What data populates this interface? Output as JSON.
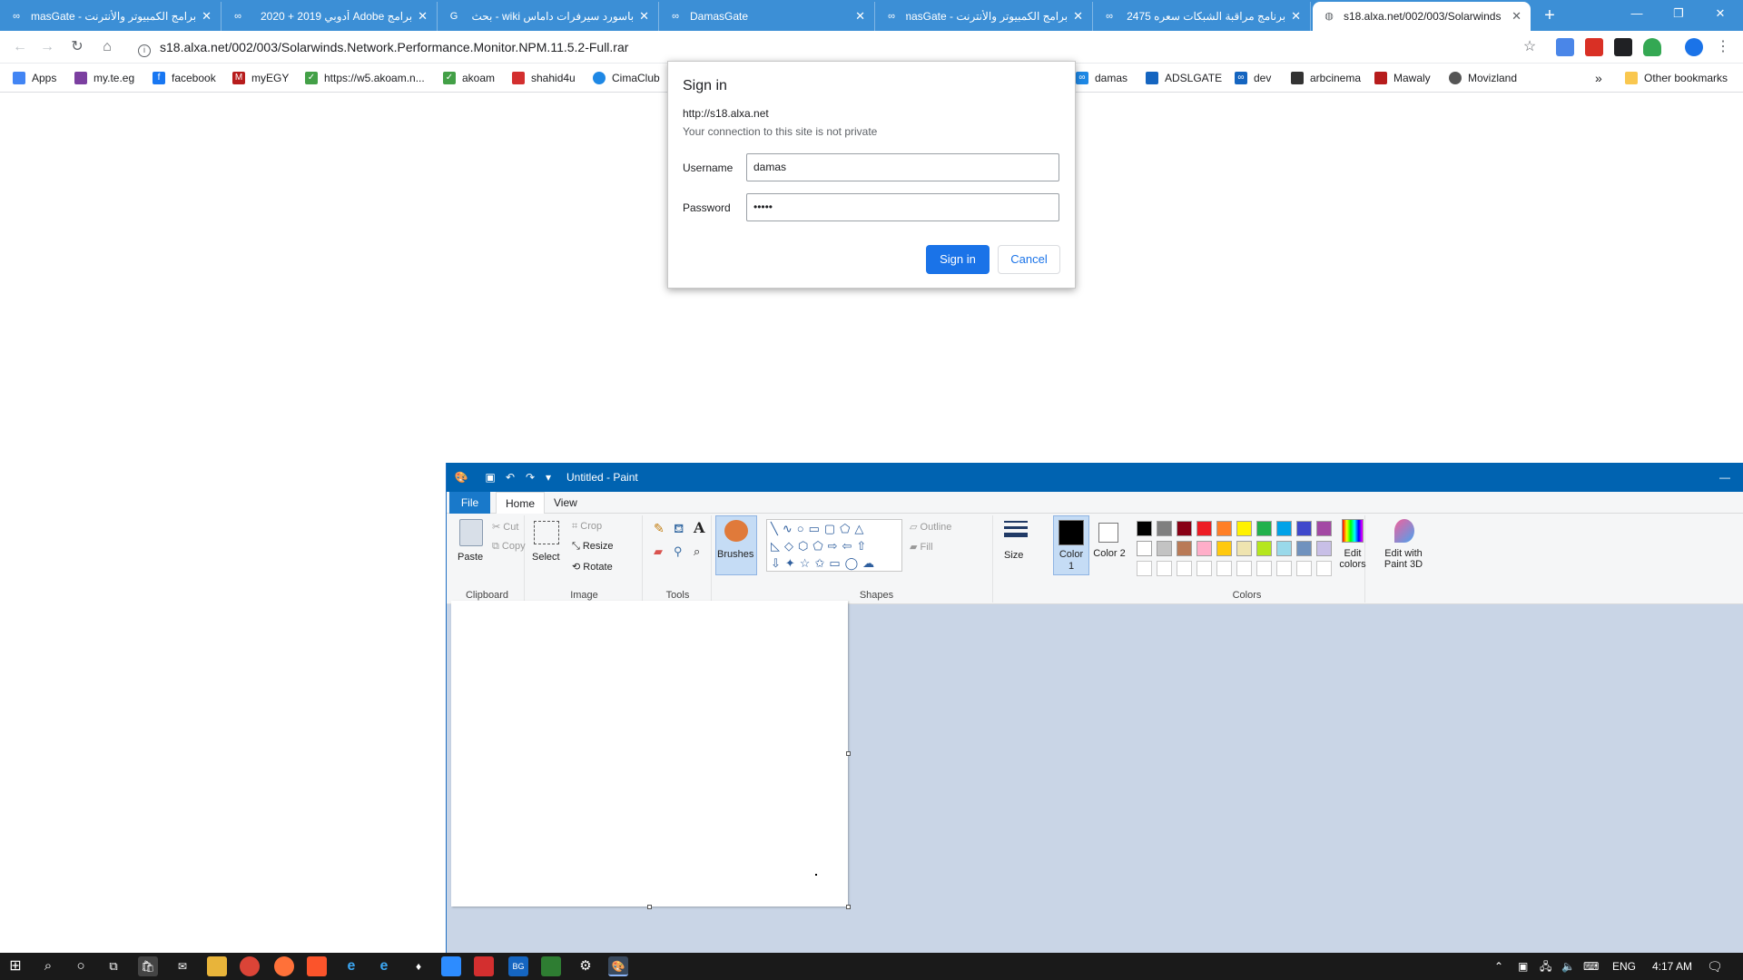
{
  "browser": {
    "tabs": [
      {
        "title": "برامج الكمبيوتر والأنترنت - masGate"
      },
      {
        "title": "برامج Adobe أدوبي 2019 + 2020"
      },
      {
        "title": "باسورد سيرفرات داماس wiki - بحث"
      },
      {
        "title": "DamasGate"
      },
      {
        "title": "برامج الكمبيوتر والأنترنت - masGate"
      },
      {
        "title": "برنامج مراقبة الشبكات سعره 2475"
      },
      {
        "title": "s18.alxa.net/002/003/Solarwinds"
      }
    ],
    "address": "s18.alxa.net/002/003/Solarwinds.Network.Performance.Monitor.NPM.11.5.2-Full.rar",
    "bookmarks": [
      {
        "label": "Apps",
        "color": "#4285f4"
      },
      {
        "label": "my.te.eg",
        "color": "#7b3fa0"
      },
      {
        "label": "facebook",
        "color": "#1877f2"
      },
      {
        "label": "myEGY",
        "color": "#b71c1c"
      },
      {
        "label": "https://w5.akoam.n...",
        "color": "#43a047"
      },
      {
        "label": "akoam",
        "color": "#43a047"
      },
      {
        "label": "shahid4u",
        "color": "#d32f2f"
      },
      {
        "label": "CimaClub",
        "color": "#1e88e5"
      },
      {
        "label": "damas",
        "color": "#1e88e5"
      },
      {
        "label": "ADSLGATE",
        "color": "#1565c0"
      },
      {
        "label": "dev",
        "color": "#1565c0"
      },
      {
        "label": "arbcinema",
        "color": "#333333"
      },
      {
        "label": "Mawaly",
        "color": "#b71c1c"
      },
      {
        "label": "Movizland",
        "color": "#555555"
      },
      {
        "label": "Other bookmarks",
        "color": "#f9c74f"
      }
    ]
  },
  "dialog": {
    "title": "Sign in",
    "url": "http://s18.alxa.net",
    "subtitle": "Your connection to this site is not private",
    "username_label": "Username",
    "username_value": "damas",
    "password_label": "Password",
    "password_value": "•••••",
    "signin": "Sign in",
    "cancel": "Cancel"
  },
  "paint": {
    "title": "Untitled - Paint",
    "tabs": {
      "file": "File",
      "home": "Home",
      "view": "View"
    },
    "clipboard": {
      "paste": "Paste",
      "cut": "Cut",
      "copy": "Copy",
      "label": "Clipboard"
    },
    "image": {
      "select": "Select",
      "crop": "Crop",
      "resize": "Resize",
      "rotate": "Rotate",
      "label": "Image"
    },
    "tools": {
      "label": "Tools"
    },
    "brushes": "Brushes",
    "shapes": {
      "outline": "Outline",
      "fill": "Fill",
      "label": "Shapes"
    },
    "size": "Size",
    "color1": "Color 1",
    "color2": "Color 2",
    "colors_label": "Colors",
    "edit_colors": "Edit colors",
    "edit_3d": "Edit with Paint 3D",
    "palette": [
      "#000000",
      "#7f7f7f",
      "#880015",
      "#ed1c24",
      "#ff7f27",
      "#fff200",
      "#22b14c",
      "#00a2e8",
      "#3f48cc",
      "#a349a4",
      "#ffffff",
      "#c3c3c3",
      "#b97a57",
      "#ffaec9",
      "#ffc90e",
      "#efe4b0",
      "#b5e61d",
      "#99d9ea",
      "#7092be",
      "#c8bfe7"
    ]
  },
  "taskbar": {
    "lang": "ENG",
    "time": "4:17 AM"
  }
}
